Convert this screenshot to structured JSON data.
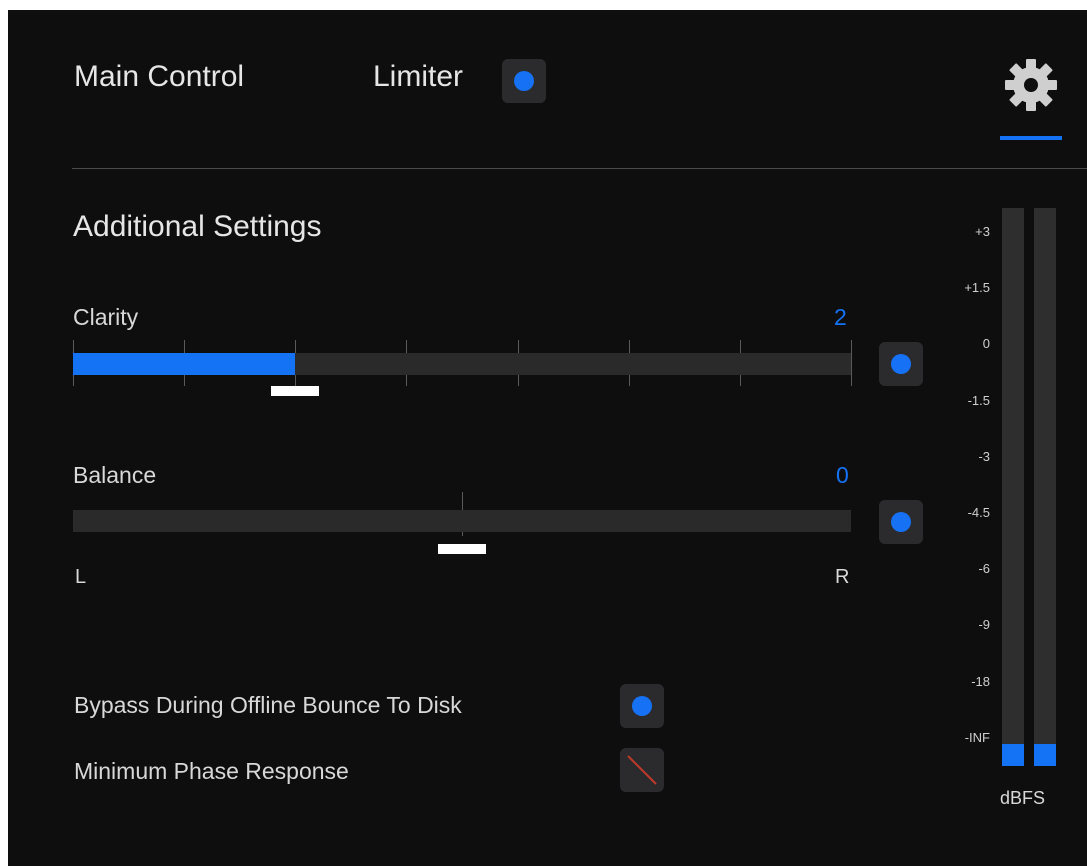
{
  "header": {
    "title": "Main Control",
    "limiter_label": "Limiter",
    "limiter_on": true,
    "settings_icon": "gear-icon"
  },
  "section": {
    "title": "Additional Settings"
  },
  "clarity": {
    "label": "Clarity",
    "value": "2",
    "fraction": 0.285,
    "enabled": true
  },
  "balance": {
    "label": "Balance",
    "value": "0",
    "fraction": 0.5,
    "left_label": "L",
    "right_label": "R",
    "enabled": true
  },
  "options": [
    {
      "label": "Bypass During Offline Bounce To Disk",
      "state": "on"
    },
    {
      "label": "Minimum Phase Response",
      "state": "disabled"
    }
  ],
  "meter": {
    "scale": [
      "+3",
      "+1.5",
      "0",
      "-1.5",
      "-3",
      "-4.5",
      "-6",
      "-9",
      "-18",
      "-INF"
    ],
    "unit": "dBFS",
    "left_level": 0.0,
    "right_level": 0.0
  },
  "colors": {
    "accent": "#1472f5",
    "background": "#0e0e0f",
    "disabled_slash": "#c0392b"
  }
}
